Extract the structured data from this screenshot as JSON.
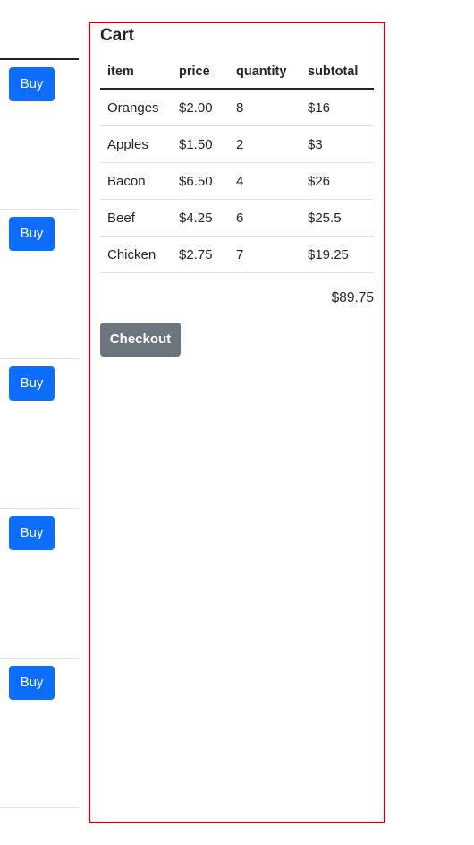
{
  "products": {
    "buy_label": "Buy"
  },
  "cart": {
    "title": "Cart",
    "columns": [
      "item",
      "price",
      "quantity",
      "subtotal"
    ],
    "rows": [
      {
        "item": "Oranges",
        "price": "$2.00",
        "quantity": "8",
        "subtotal": "$16"
      },
      {
        "item": "Apples",
        "price": "$1.50",
        "quantity": "2",
        "subtotal": "$3"
      },
      {
        "item": "Bacon",
        "price": "$6.50",
        "quantity": "4",
        "subtotal": "$26"
      },
      {
        "item": "Beef",
        "price": "$4.25",
        "quantity": "6",
        "subtotal": "$25.5"
      },
      {
        "item": "Chicken",
        "price": "$2.75",
        "quantity": "7",
        "subtotal": "$19.25"
      }
    ],
    "total": "$89.75",
    "checkout_label": "Checkout"
  },
  "colors": {
    "primary": "#0d6efd",
    "secondary": "#6c757d",
    "panel_border": "#d10000"
  }
}
